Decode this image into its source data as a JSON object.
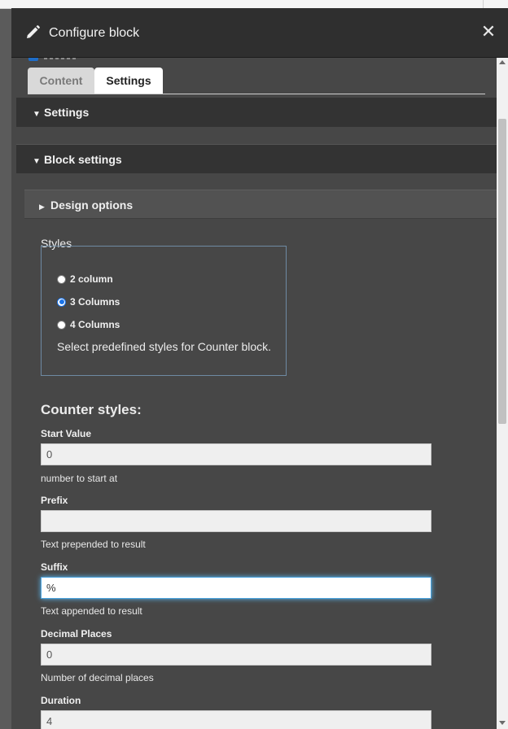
{
  "dialog": {
    "title": "Configure block",
    "close_glyph": "✕"
  },
  "tabs": [
    {
      "label": "Content",
      "active": false
    },
    {
      "label": "Settings",
      "active": true
    }
  ],
  "sections": {
    "settings": {
      "label": "Settings",
      "expanded": true
    },
    "block_settings": {
      "label": "Block settings",
      "expanded": true
    },
    "design_options": {
      "label": "Design options",
      "expanded": false
    }
  },
  "styles": {
    "label": "Styles",
    "options": [
      {
        "label": "2 column",
        "checked": false
      },
      {
        "label": "3 Columns",
        "checked": true
      },
      {
        "label": "4 Columns",
        "checked": false
      }
    ],
    "description": "Select predefined styles for Counter block."
  },
  "counter": {
    "heading": "Counter styles:",
    "fields": [
      {
        "label": "Start Value",
        "value": "0",
        "help": "number to start at"
      },
      {
        "label": "Prefix",
        "value": "",
        "help": "Text prepended to result"
      },
      {
        "label": "Suffix",
        "value": "%",
        "help": "Text appended to result",
        "focused": true
      },
      {
        "label": "Decimal Places",
        "value": "0",
        "help": "Number of decimal places"
      },
      {
        "label": "Duration",
        "value": "4",
        "help": ""
      }
    ]
  },
  "colors": {
    "titlebar": "#2f2f2f",
    "panel": "#474747",
    "section_header": "#333333",
    "focus": "#4aa3df",
    "radio_accent": "#1a73e8"
  },
  "icons": {
    "title": "pencil-icon",
    "close": "close-icon"
  }
}
